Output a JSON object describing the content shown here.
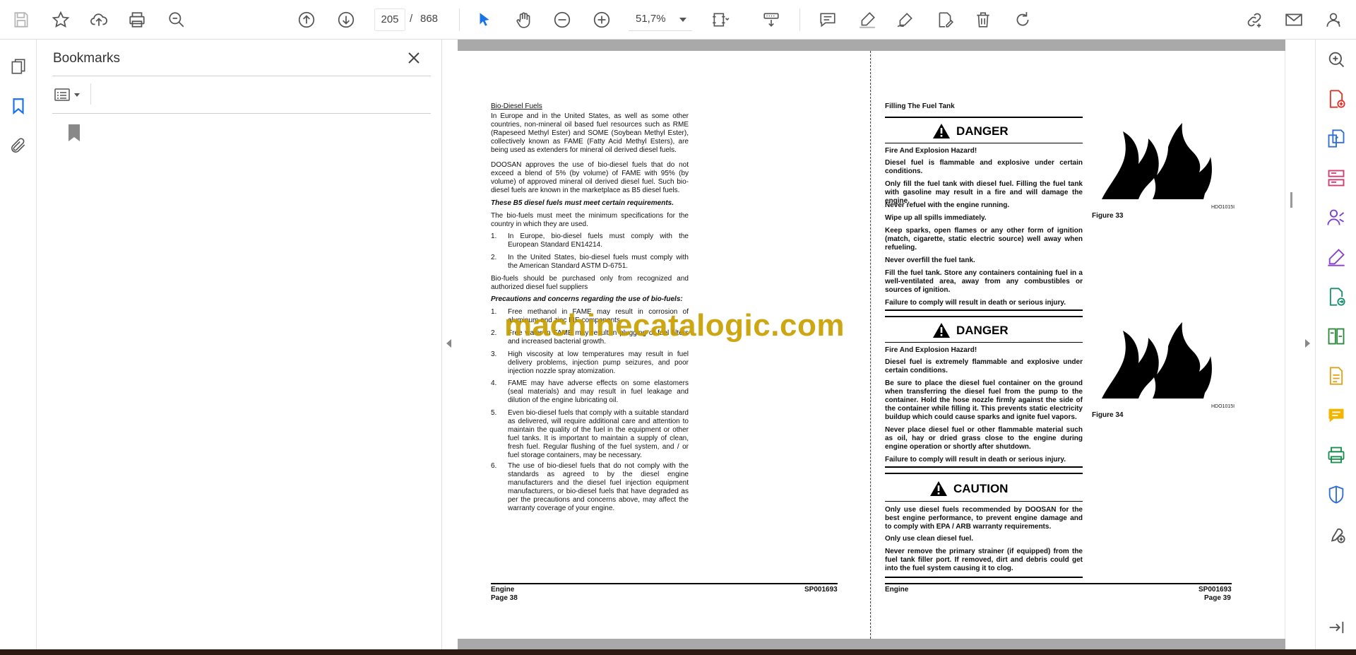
{
  "toolbar": {
    "current_page": "205",
    "page_separator": "/",
    "total_pages": "868",
    "zoom": "51,7%"
  },
  "bookmarks": {
    "title": "Bookmarks"
  },
  "left_page": {
    "heading": "Bio-Diesel Fuels",
    "p1": "In Europe and in the United States, as well as some other countries, non-mineral oil based fuel resources such as RME (Rapeseed Methyl Ester) and SOME (Soybean Methyl Ester), collectively known as FAME (Fatty Acid Methyl Esters), are being used as extenders for mineral oil derived diesel fuels.",
    "p2": "DOOSAN approves the use of bio-diesel fuels that do not exceed a blend of 5% (by volume) of FAME with 95% (by volume) of approved mineral oil derived diesel fuel. Such bio-diesel fuels are known in the marketplace as B5 diesel fuels.",
    "subhead1": "These B5 diesel fuels must meet certain requirements.",
    "p3": "The bio-fuels must meet the minimum specifications for the country in which they are used.",
    "req1_num": "1.",
    "req1": "In Europe, bio-diesel fuels must comply with the European Standard EN14214.",
    "req2_num": "2.",
    "req2": "In the United States, bio-diesel fuels must comply with the American Standard ASTM D-6751.",
    "p4": "Bio-fuels should be purchased only from recognized and authorized diesel fuel suppliers",
    "subhead2": "Precautions and concerns regarding the use of bio-fuels:",
    "c1_num": "1.",
    "c1": "Free methanol in FAME may result in corrosion of aluminum and zinc FIE components.",
    "c2_num": "2.",
    "c2": "Free water in FAME may result in plugging of fuel filters and increased bacterial growth.",
    "c3_num": "3.",
    "c3": "High viscosity at low temperatures may result in fuel delivery problems, injection pump seizures, and poor injection nozzle spray atomization.",
    "c4_num": "4.",
    "c4": "FAME may have adverse effects on some elastomers (seal materials) and may result in fuel leakage and dilution of the engine lubricating oil.",
    "c5_num": "5.",
    "c5": "Even bio-diesel fuels that comply with a suitable standard as delivered, will require additional care and attention to maintain the quality of the fuel in the equipment or other fuel tanks. It is important to maintain a supply of clean, fresh fuel. Regular flushing of the fuel system, and / or fuel storage containers, may be necessary.",
    "c6_num": "6.",
    "c6": "The use of bio-diesel fuels that do not comply with the standards as agreed to by the diesel engine manufacturers and the diesel fuel injection equipment manufacturers, or bio-diesel fuels that have degraded as per the precautions and concerns above, may affect the warranty coverage of your engine.",
    "footer_left1": "Engine",
    "footer_left2": "Page 38",
    "footer_right": "SP001693"
  },
  "right_page": {
    "heading": "Filling The Fuel Tank",
    "danger1_title": "DANGER",
    "d1_l1": "Fire And Explosion Hazard!",
    "d1_l2": "Diesel fuel is flammable and explosive under certain conditions.",
    "d1_l3": "Only fill the fuel tank with diesel fuel. Filling the fuel tank with gasoline may result in a fire and will damage the engine.",
    "d1_l4": "Never refuel with the engine running.",
    "d1_l5": "Wipe up all spills immediately.",
    "d1_l6": "Keep sparks, open flames or any other form of ignition (match, cigarette, static electric source) well away when refueling.",
    "d1_l7": "Never overfill the fuel tank.",
    "d1_l8": "Fill the fuel tank. Store any containers containing fuel in a well-ventilated area, away from any combustibles or sources of ignition.",
    "d1_l9": "Failure to comply will result in death or serious injury.",
    "danger2_title": "DANGER",
    "d2_l1": "Fire And Explosion Hazard!",
    "d2_l2": "Diesel fuel is extremely flammable and explosive under certain conditions.",
    "d2_l3": "Be sure to place the diesel fuel container on the ground when transferring the diesel fuel from the pump to the container. Hold the hose nozzle firmly against the side of the container while filling it. This prevents static electricity buildup which could cause sparks and ignite fuel vapors.",
    "d2_l4": "Never place diesel fuel or other flammable material such as oil, hay or dried grass close to the engine during engine operation or shortly after shutdown.",
    "d2_l5": "Failure to comply will result in death or serious injury.",
    "caution_title": "CAUTION",
    "c_l1": "Only use diesel fuels recommended by DOOSAN for the best engine performance, to prevent engine damage and to comply with EPA / ARB warranty requirements.",
    "c_l2": "Only use clean diesel fuel.",
    "c_l3": "Never remove the primary strainer (if equipped) from the fuel tank filler port. If removed, dirt and debris could get into the fuel system causing it to clog.",
    "fig33_code": "HDO1015I",
    "fig33_caption": "Figure 33",
    "fig34_code": "HDO1015I",
    "fig34_caption": "Figure 34",
    "footer_left": "Engine",
    "footer_right1": "SP001693",
    "footer_right2": "Page 39"
  },
  "watermark": "machinecatalogic.com"
}
